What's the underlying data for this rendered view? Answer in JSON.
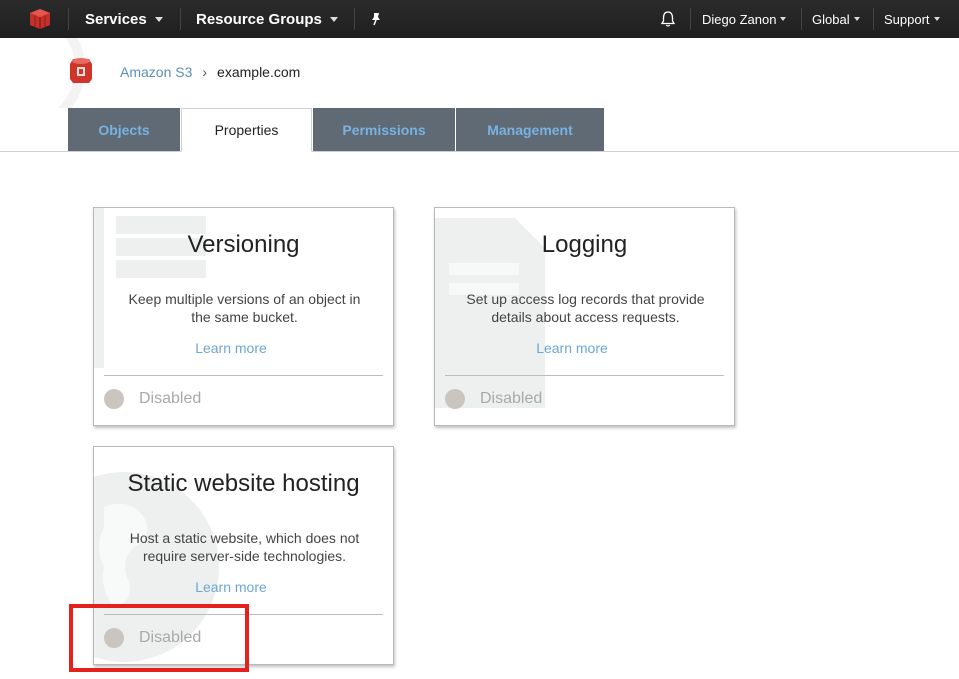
{
  "nav": {
    "services": "Services",
    "resource_groups": "Resource Groups",
    "user": "Diego Zanon",
    "region": "Global",
    "support": "Support"
  },
  "breadcrumb": {
    "service": "Amazon S3",
    "bucket": "example.com"
  },
  "tabs": [
    "Objects",
    "Properties",
    "Permissions",
    "Management"
  ],
  "active_tab": "Properties",
  "cards": [
    {
      "title": "Versioning",
      "description": "Keep multiple versions of an object in the same bucket.",
      "learn_more": "Learn more",
      "status": "Disabled"
    },
    {
      "title": "Logging",
      "description": "Set up access log records that provide details about access requests.",
      "learn_more": "Learn more",
      "status": "Disabled"
    },
    {
      "title": "Static website hosting",
      "description": "Host a static website, which does not require server-side technologies.",
      "learn_more": "Learn more",
      "status": "Disabled"
    }
  ],
  "colors": {
    "topbar": "#232323",
    "tab_inactive_bg": "#5f6a75",
    "tab_inactive_text": "#79b1e0",
    "link": "#6ea6d2",
    "highlight": "#e4211c",
    "status_dot": "#cbc5c0"
  },
  "icons": {
    "logo": "aws-cube-icon",
    "pin": "pin-icon",
    "bell": "bell-icon",
    "s3": "s3-bucket-icon"
  }
}
